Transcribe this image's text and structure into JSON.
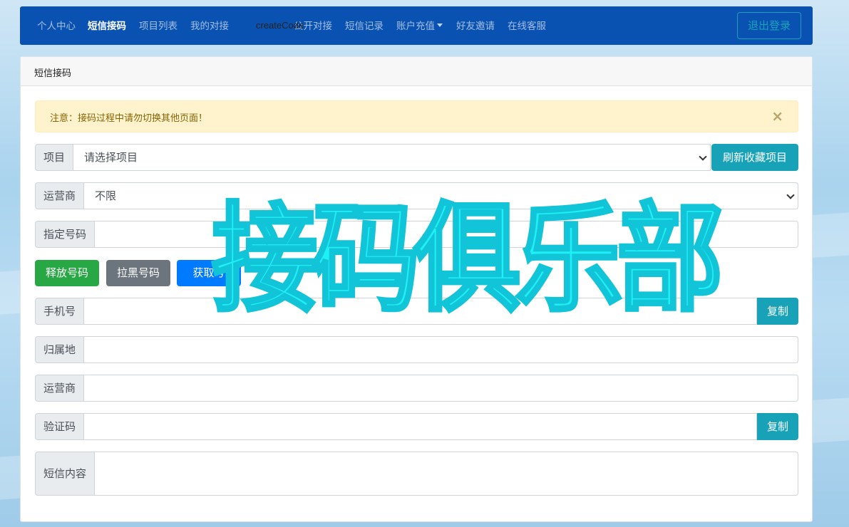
{
  "nav": {
    "items": [
      {
        "label": "个人中心"
      },
      {
        "label": "短信接码"
      },
      {
        "label": "项目列表"
      },
      {
        "label": "我的对接"
      },
      {
        "label": "公开对接"
      },
      {
        "label": "短信记录"
      },
      {
        "label": "账户充值"
      },
      {
        "label": "好友邀请"
      },
      {
        "label": "在线客服"
      }
    ],
    "stray_label": "createCode",
    "logout_label": "退出登录"
  },
  "card": {
    "header": "短信接码",
    "alert": "注意：接码过程中请勿切换其他页面！",
    "alert_close": "×"
  },
  "form": {
    "project": {
      "label": "项目",
      "value": "请选择项目",
      "button": "刷新收藏项目"
    },
    "carrier": {
      "label": "运营商",
      "value": "不限"
    },
    "number": {
      "label": "指定号码",
      "value": ""
    },
    "actions": {
      "release": "释放号码",
      "blacklist": "拉黑号码",
      "get": "获取号"
    },
    "phone": {
      "label": "手机号",
      "value": "",
      "copy": "复制"
    },
    "location": {
      "label": "归属地",
      "value": ""
    },
    "operator": {
      "label": "运营商",
      "value": ""
    },
    "code": {
      "label": "验证码",
      "value": "",
      "copy": "复制"
    },
    "sms": {
      "label": "短信内容",
      "value": ""
    }
  },
  "watermark": "接码俱乐部"
}
